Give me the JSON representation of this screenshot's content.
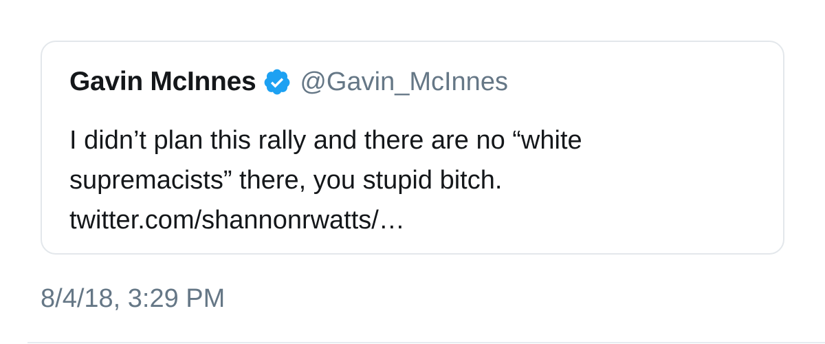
{
  "quoted_tweet": {
    "author_name": "Gavin McInnes",
    "verified_icon": "verified-check-icon",
    "handle": "@Gavin_McInnes",
    "text_lines": [
      "I didn’t plan this rally and there are no “white",
      "supremacists” there, you stupid bitch.",
      "twitter.com/shannonrwatts/…"
    ]
  },
  "timestamp": "8/4/18, 3:29 PM",
  "colors": {
    "verified_blue": "#1da1f2",
    "secondary_text": "#657786",
    "primary_text": "#14171a",
    "card_border": "#e3e7eb"
  }
}
